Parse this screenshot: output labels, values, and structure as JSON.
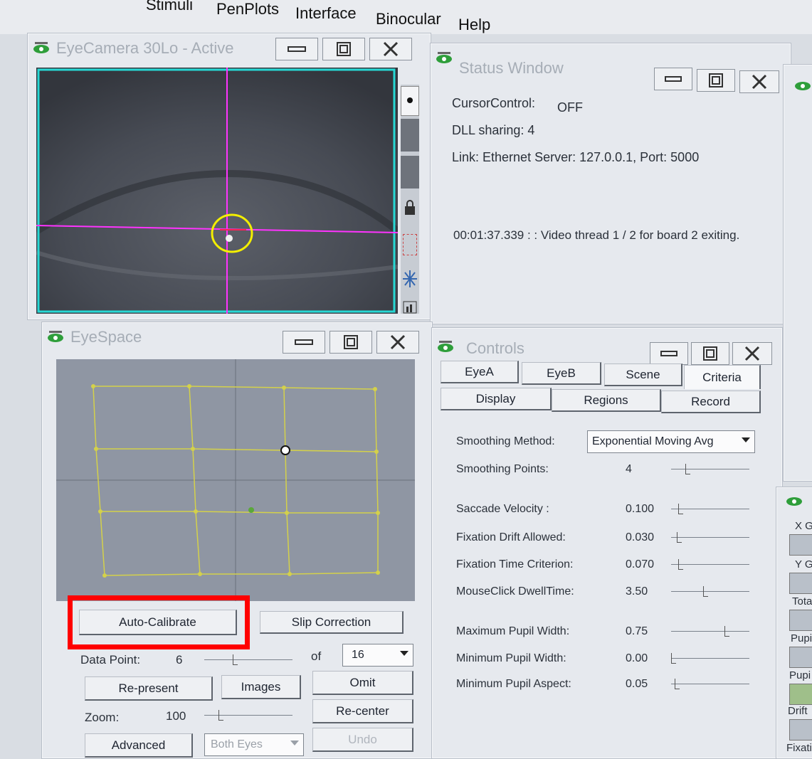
{
  "menu": {
    "items": [
      "Stimuli",
      "PenPlots",
      "Interface",
      "Binocular",
      "Help"
    ]
  },
  "eye_camera": {
    "title": "EyeCamera 30Lo - Active"
  },
  "status_window": {
    "title": "Status Window",
    "cursor_control_label": "CursorControl:",
    "cursor_control_value": "OFF",
    "dll_sharing": "DLL sharing: 4",
    "link": "Link:  Ethernet Server: 127.0.0.1, Port: 5000",
    "message": "00:01:37.339 :  : Video thread 1 / 2 for board 2 exiting."
  },
  "eye_space": {
    "title": "EyeSpace",
    "buttons": {
      "auto_calibrate": "Auto-Calibrate",
      "slip_correction": "Slip Correction",
      "re_present": "Re-present",
      "images": "Images",
      "omit": "Omit",
      "re_center": "Re-center",
      "advanced": "Advanced",
      "undo": "Undo"
    },
    "data_point_label": "Data Point:",
    "data_point_value": "6",
    "of_label": "of",
    "of_value": "16",
    "zoom_label": "Zoom:",
    "zoom_value": "100",
    "eye_select": "Both Eyes"
  },
  "controls": {
    "title": "Controls",
    "tabs_row1": [
      "EyeA",
      "EyeB",
      "Scene",
      "Criteria"
    ],
    "tabs_row2": [
      "Display",
      "Regions",
      "Record"
    ],
    "active_tab": "Criteria",
    "smoothing_method_label": "Smoothing Method:",
    "smoothing_method_value": "Exponential Moving Avg",
    "params": [
      {
        "label": "Smoothing Points:",
        "value": "4",
        "level": 0.2
      },
      {
        "label": "Saccade Velocity :",
        "value": "0.100",
        "level": 0.1
      },
      {
        "label": "Fixation Drift Allowed:",
        "value": "0.030",
        "level": 0.08
      },
      {
        "label": "Fixation Time Criterion:",
        "value": "0.070",
        "level": 0.1
      },
      {
        "label": "MouseClick DwellTime:",
        "value": "3.50",
        "level": 0.45
      },
      {
        "label": "Maximum Pupil Width:",
        "value": "0.75",
        "level": 0.75
      },
      {
        "label": "Minimum Pupil Width:",
        "value": "0.00",
        "level": 0.0
      },
      {
        "label": "Minimum Pupil Aspect:",
        "value": "0.05",
        "level": 0.05
      }
    ]
  },
  "side_panel": {
    "labels": [
      "X G",
      "Y G",
      "Tota",
      "Pupi",
      "Pupi",
      "Drift",
      "Fixati"
    ]
  },
  "colors": {
    "accent_highlight": "#ff0000",
    "crosshair": "#ff33ff",
    "pupil_ring": "#f3ee00",
    "grid": "#d4d14a",
    "camera_border": "#27d8d4"
  }
}
